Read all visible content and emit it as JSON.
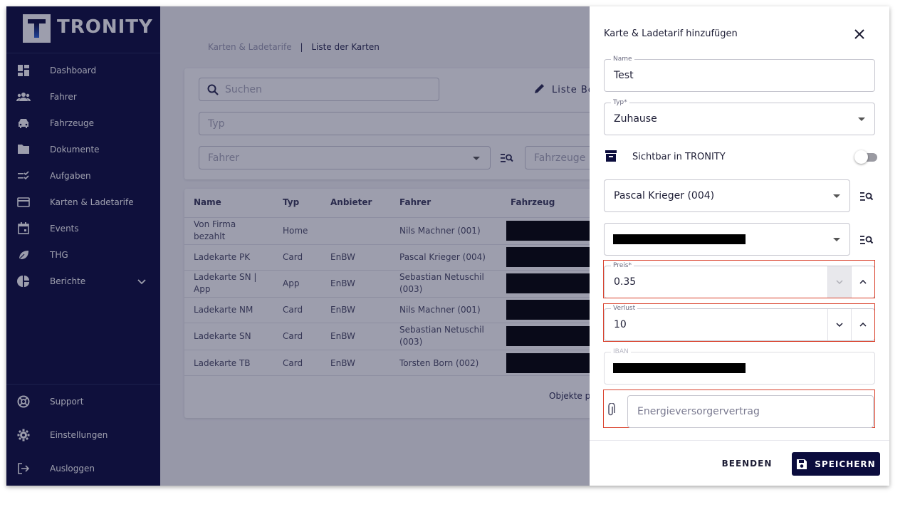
{
  "brand": {
    "name": "TRONITY"
  },
  "sidebar": {
    "items": [
      {
        "label": "Dashboard",
        "icon": "dashboard-icon"
      },
      {
        "label": "Fahrer",
        "icon": "people-icon"
      },
      {
        "label": "Fahrzeuge",
        "icon": "car-icon"
      },
      {
        "label": "Dokumente",
        "icon": "folder-icon"
      },
      {
        "label": "Aufgaben",
        "icon": "checklist-icon"
      },
      {
        "label": "Karten & Ladetarife",
        "icon": "credit-card-icon"
      },
      {
        "label": "Events",
        "icon": "calendar-icon"
      },
      {
        "label": "THG",
        "icon": "leaf-icon"
      },
      {
        "label": "Berichte",
        "icon": "pie-chart-icon"
      }
    ],
    "bottom": [
      {
        "label": "Support",
        "icon": "lifebuoy-icon"
      },
      {
        "label": "Einstellungen",
        "icon": "gear-icon"
      },
      {
        "label": "Ausloggen",
        "icon": "logout-icon"
      }
    ]
  },
  "breadcrumb": {
    "parent": "Karten & Ladetarife",
    "separator": "|",
    "current": "Liste der Karten"
  },
  "filters": {
    "search_placeholder": "Suchen",
    "edit_list_label": "Liste Be",
    "type_placeholder": "Typ",
    "driver_placeholder": "Fahrer",
    "vehicle_placeholder": "Fahrzeuge"
  },
  "table": {
    "columns": [
      "Name",
      "Typ",
      "Anbieter",
      "Fahrer",
      "Fahrzeug"
    ],
    "rows": [
      {
        "name": "Von Firma bezahlt",
        "typ": "Home",
        "anbieter": "",
        "fahrer": "Nils Machner (001)"
      },
      {
        "name": "Ladekarte PK",
        "typ": "Card",
        "anbieter": "EnBW",
        "fahrer": "Pascal Krieger (004)"
      },
      {
        "name": "Ladekarte SN | App",
        "typ": "App",
        "anbieter": "EnBW",
        "fahrer": "Sebastian Netuschil (003)"
      },
      {
        "name": "Ladekarte NM",
        "typ": "Card",
        "anbieter": "EnBW",
        "fahrer": "Nils Machner (001)"
      },
      {
        "name": "Ladekarte SN",
        "typ": "Card",
        "anbieter": "EnBW",
        "fahrer": "Sebastian Netuschil (003)"
      },
      {
        "name": "Ladekarte TB",
        "typ": "Card",
        "anbieter": "EnBW",
        "fahrer": "Torsten Born (002)"
      }
    ],
    "footer": "Objekte p"
  },
  "drawer": {
    "title": "Karte & Ladetarif hinzufügen",
    "name": {
      "label": "Name",
      "value": "Test"
    },
    "typ": {
      "label": "Typ*",
      "value": "Zuhause"
    },
    "visible": {
      "label": "Sichtbar in TRONITY",
      "checked": false
    },
    "driver": {
      "value": "Pascal Krieger (004)"
    },
    "preis": {
      "label": "Preis*",
      "value": "0.35"
    },
    "verlust": {
      "label": "Verlust",
      "value": "10"
    },
    "iban": {
      "label": "IBAN"
    },
    "attachment": {
      "placeholder": "Energieversorgervertrag"
    },
    "cancel_label": "BEENDEN",
    "save_label": "SPEICHERN"
  },
  "colors": {
    "sidebar": "#0b0c3d",
    "accent": "#0b0c3d",
    "highlight": "#d9402b"
  }
}
